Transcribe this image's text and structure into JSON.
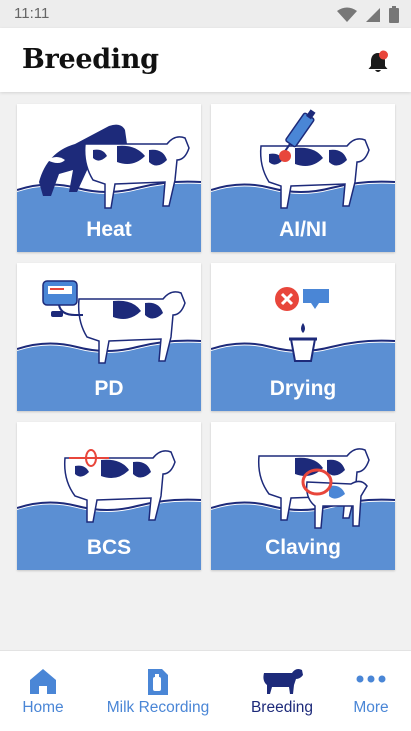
{
  "status_bar": {
    "time": "11:11"
  },
  "header": {
    "title": "Breeding"
  },
  "tiles": [
    {
      "label": "Heat"
    },
    {
      "label": "AI/NI"
    },
    {
      "label": "PD"
    },
    {
      "label": "Drying"
    },
    {
      "label": "BCS"
    },
    {
      "label": "Claving"
    }
  ],
  "nav": [
    {
      "label": "Home"
    },
    {
      "label": "Milk Recording"
    },
    {
      "label": "Breeding"
    },
    {
      "label": "More"
    }
  ],
  "colors": {
    "accent": "#4a86d6",
    "navy": "#1d2a7a",
    "water": "#5b8fd3",
    "notification_dot": "#e8463b"
  }
}
